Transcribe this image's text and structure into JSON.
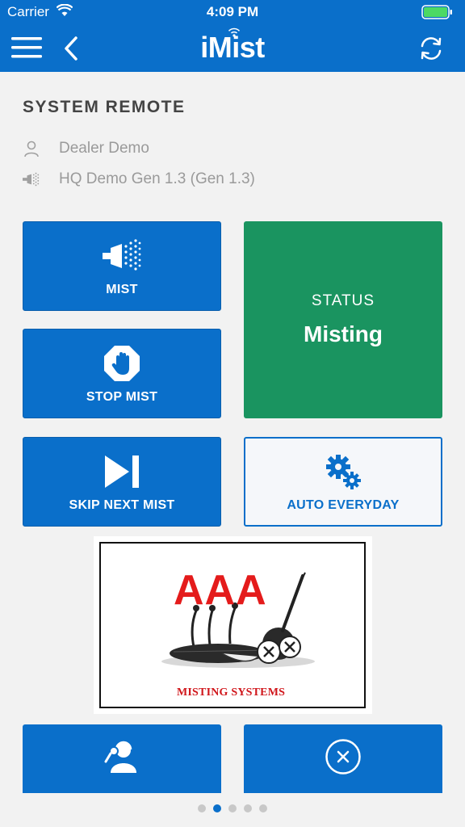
{
  "status_bar": {
    "carrier": "Carrier",
    "time": "4:09 PM"
  },
  "navbar": {
    "title": "iMist"
  },
  "section": {
    "title": "SYSTEM REMOTE"
  },
  "info": {
    "dealer": "Dealer Demo",
    "device": "HQ Demo Gen 1.3 (Gen 1.3)"
  },
  "buttons": {
    "mist": "MIST",
    "stop_mist": "STOP MIST",
    "skip_next_mist": "SKIP NEXT MIST",
    "auto_everyday": "AUTO EVERYDAY"
  },
  "status": {
    "label": "STATUS",
    "value": "Misting"
  },
  "logo": {
    "brand": "AAA",
    "tagline": "MISTING SYSTEMS"
  },
  "pager": {
    "pages": 5,
    "current": 2
  },
  "colors": {
    "primary": "#0a6fca",
    "status_green": "#1a9460",
    "logo_red": "#e41b1b"
  }
}
